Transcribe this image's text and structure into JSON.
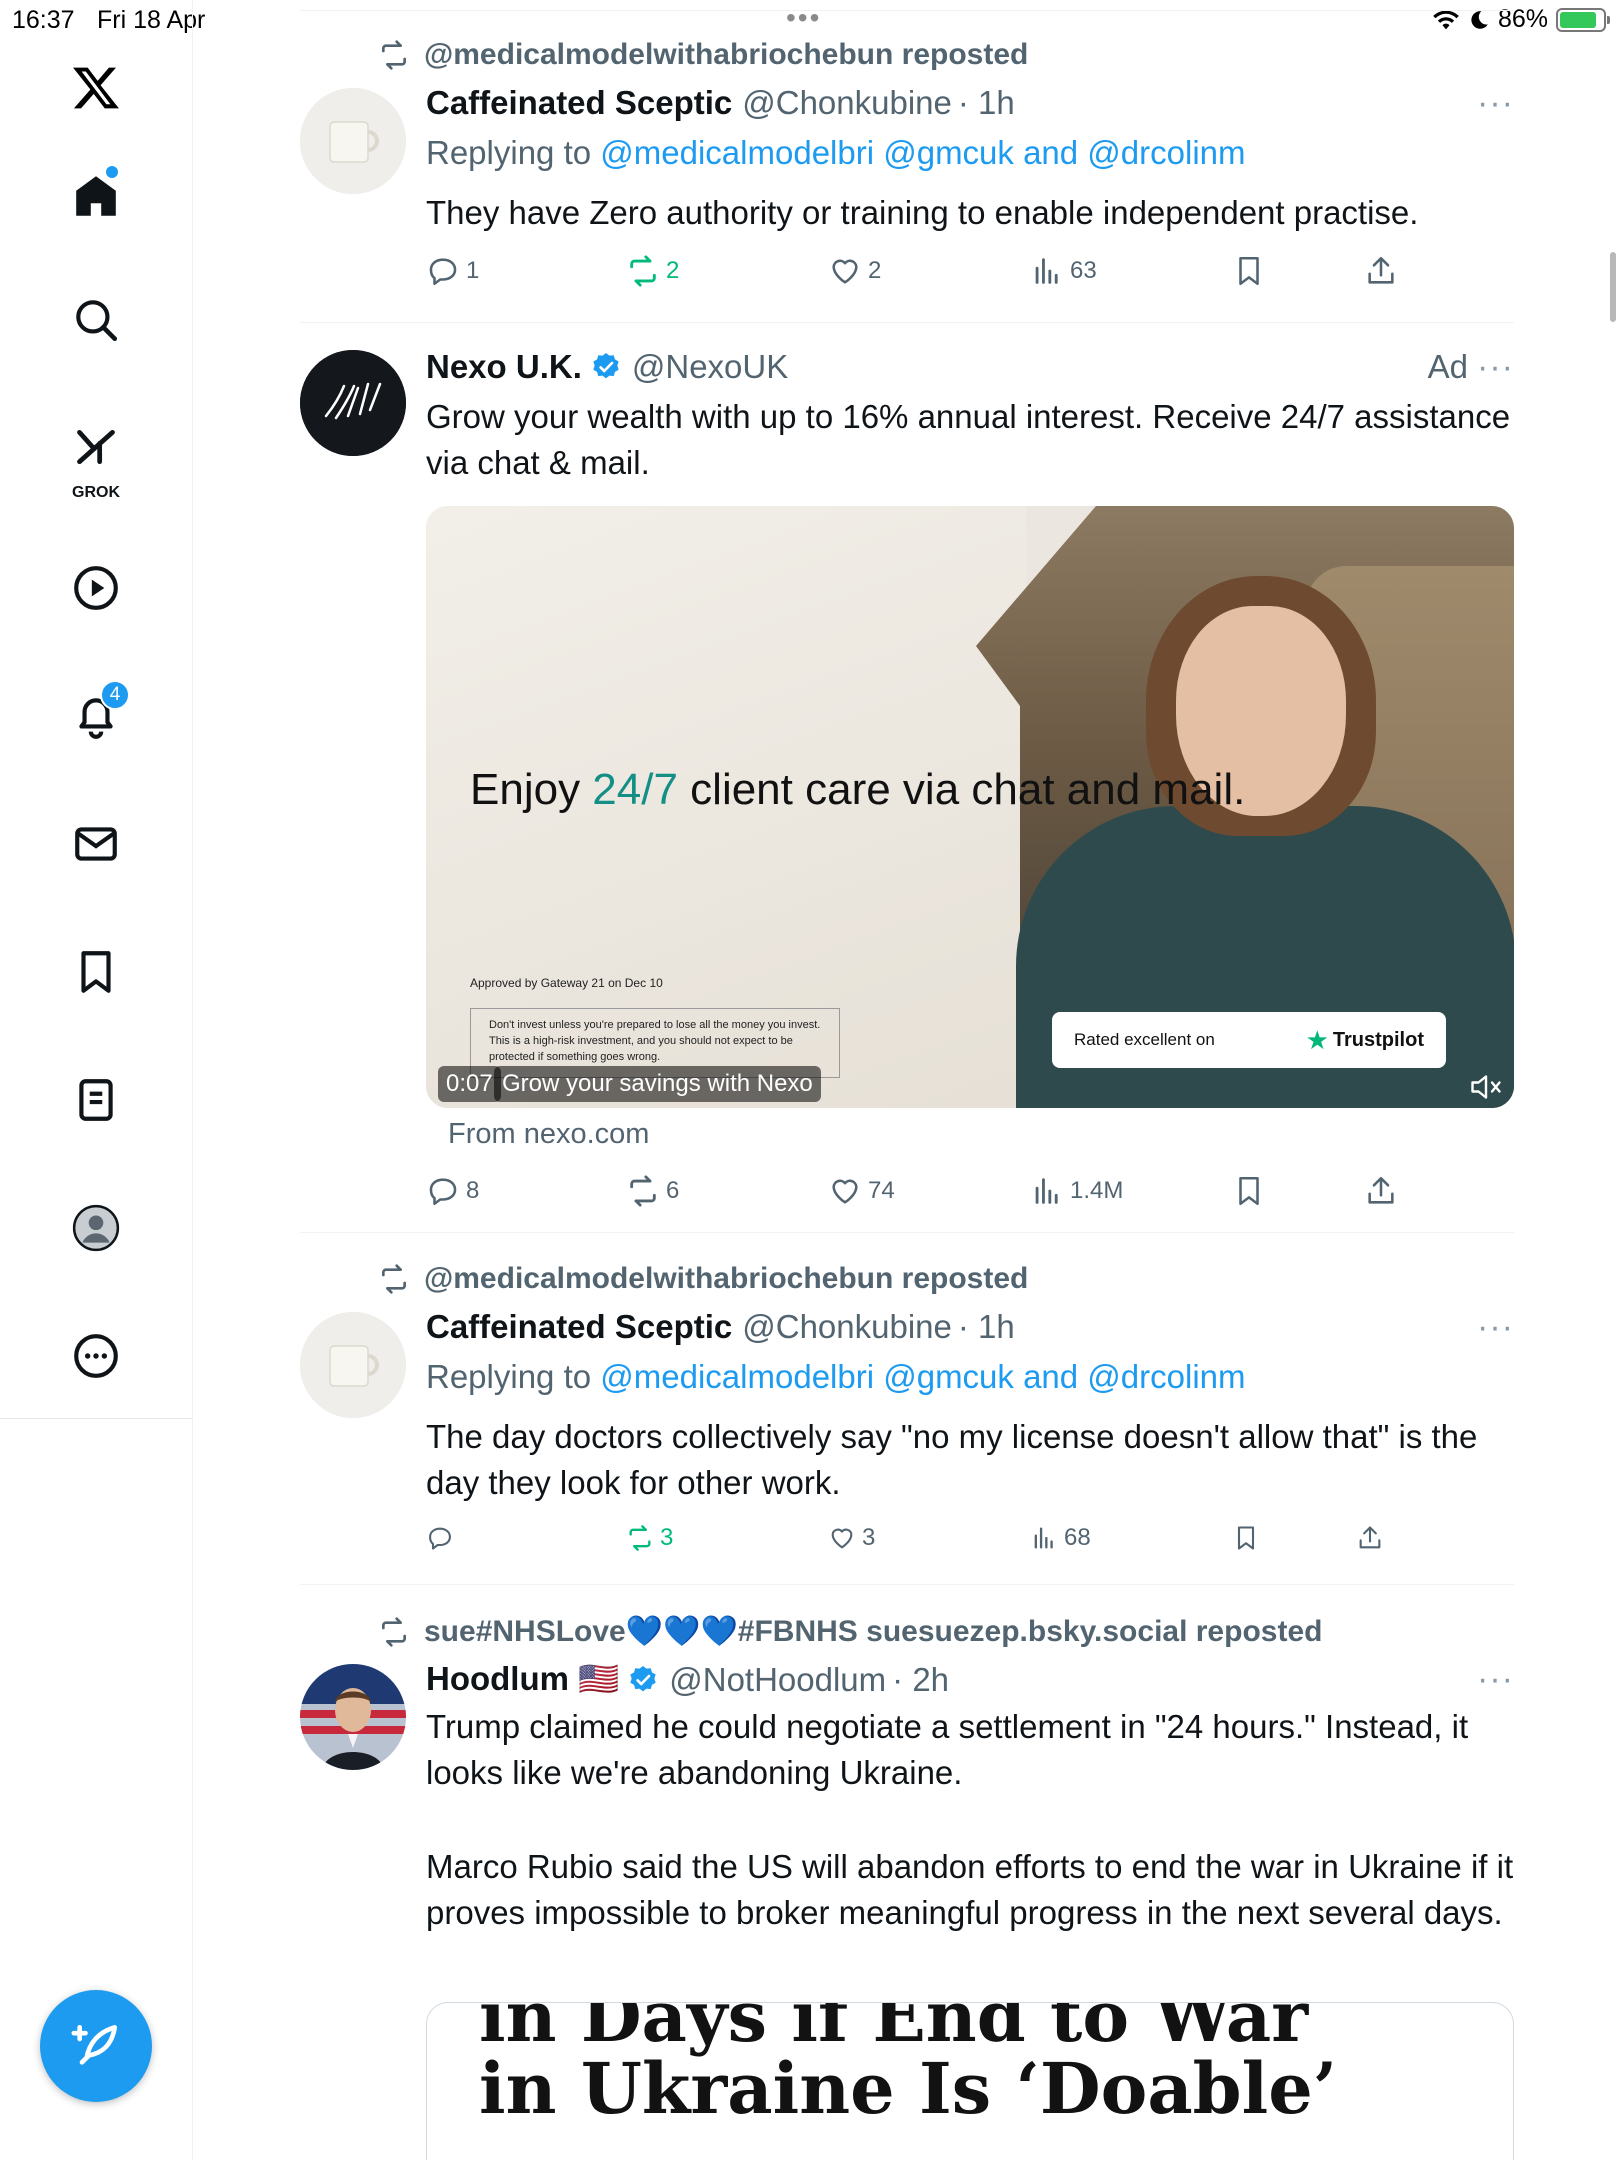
{
  "status_bar": {
    "time": "16:37",
    "date": "Fri 18 Apr",
    "battery_percent": "86%",
    "battery_level": 0.86
  },
  "sidebar": {
    "items": [
      {
        "name": "home",
        "icon": "home-icon",
        "has_dot": true
      },
      {
        "name": "search",
        "icon": "search-icon"
      },
      {
        "name": "grok",
        "icon": "grok-icon",
        "label": "GROK"
      },
      {
        "name": "videos",
        "icon": "play-icon"
      },
      {
        "name": "notifications",
        "icon": "bell-icon",
        "badge": "4"
      },
      {
        "name": "messages",
        "icon": "mail-icon"
      },
      {
        "name": "bookmarks",
        "icon": "bookmark-icon"
      },
      {
        "name": "lists",
        "icon": "list-icon"
      },
      {
        "name": "profile",
        "icon": "profile-icon"
      },
      {
        "name": "more",
        "icon": "more-circle-icon"
      }
    ],
    "compose_icon": "compose-icon"
  },
  "posts": [
    {
      "repost_by": "@medicalmodelwithabriochebun reposted",
      "name": "Caffeinated Sceptic",
      "handle": "@Chonkubine",
      "time": "· 1h",
      "reply_prefix": "Replying to",
      "reply_mentions": "@medicalmodelbri @gmcuk and @drcolinm",
      "text": "They have Zero authority or training to enable independent practise.",
      "replies": "1",
      "reposts": "2",
      "likes": "2",
      "views": "63"
    },
    {
      "name": "Nexo U.K.",
      "handle": "@NexoUK",
      "ad_label": "Ad",
      "text": "Grow your wealth with up to 16% annual interest. Receive 24/7 assistance via chat & mail.",
      "media": {
        "headline_pre": "Enjoy ",
        "headline_accent": "24/7",
        "headline_post": " client care via chat and mail.",
        "approved": "Approved by Gateway 21 on Dec 10",
        "disclaimer": "Don't invest unless you're prepared to lose all the money you invest. This is a high-risk investment, and you should not expect to be protected if something goes wrong.",
        "duration": "0:07",
        "caption": "Grow your savings with Nexo",
        "trust_text": "Rated excellent on",
        "trust_brand": "Trustpilot"
      },
      "from": "From nexo.com",
      "replies": "8",
      "reposts": "6",
      "likes": "74",
      "views": "1.4M"
    },
    {
      "repost_by": "@medicalmodelwithabriochebun reposted",
      "name": "Caffeinated Sceptic",
      "handle": "@Chonkubine",
      "time": "· 1h",
      "reply_prefix": "Replying to",
      "reply_mentions": "@medicalmodelbri @gmcuk and @drcolinm",
      "text": "The day doctors collectively say \"no my license doesn't allow that\" is the day they look for other work.",
      "replies": "",
      "reposts": "3",
      "likes": "3",
      "views": "68"
    },
    {
      "repost_by": "sue#NHSLove💙💙💙#FBNHS suesuezep.bsky.social reposted",
      "name": "Hoodlum 🇺🇸",
      "handle": "@NotHoodlum",
      "time": "· 2h",
      "text_p1": "Trump claimed he could negotiate a settlement in \"24 hours.\" Instead, it looks like we're abandoning Ukraine.",
      "text_p2": "Marco Rubio said the US will abandon efforts to end the war in Ukraine if it proves impossible to broker meaningful progress in the next several days.",
      "article_line1": "in Days if End to War",
      "article_line2": "in Ukraine Is ‘Doable’"
    }
  ],
  "colors": {
    "accent": "#1d9bf0",
    "repost_green": "#00ba7c",
    "muted": "#536471"
  }
}
